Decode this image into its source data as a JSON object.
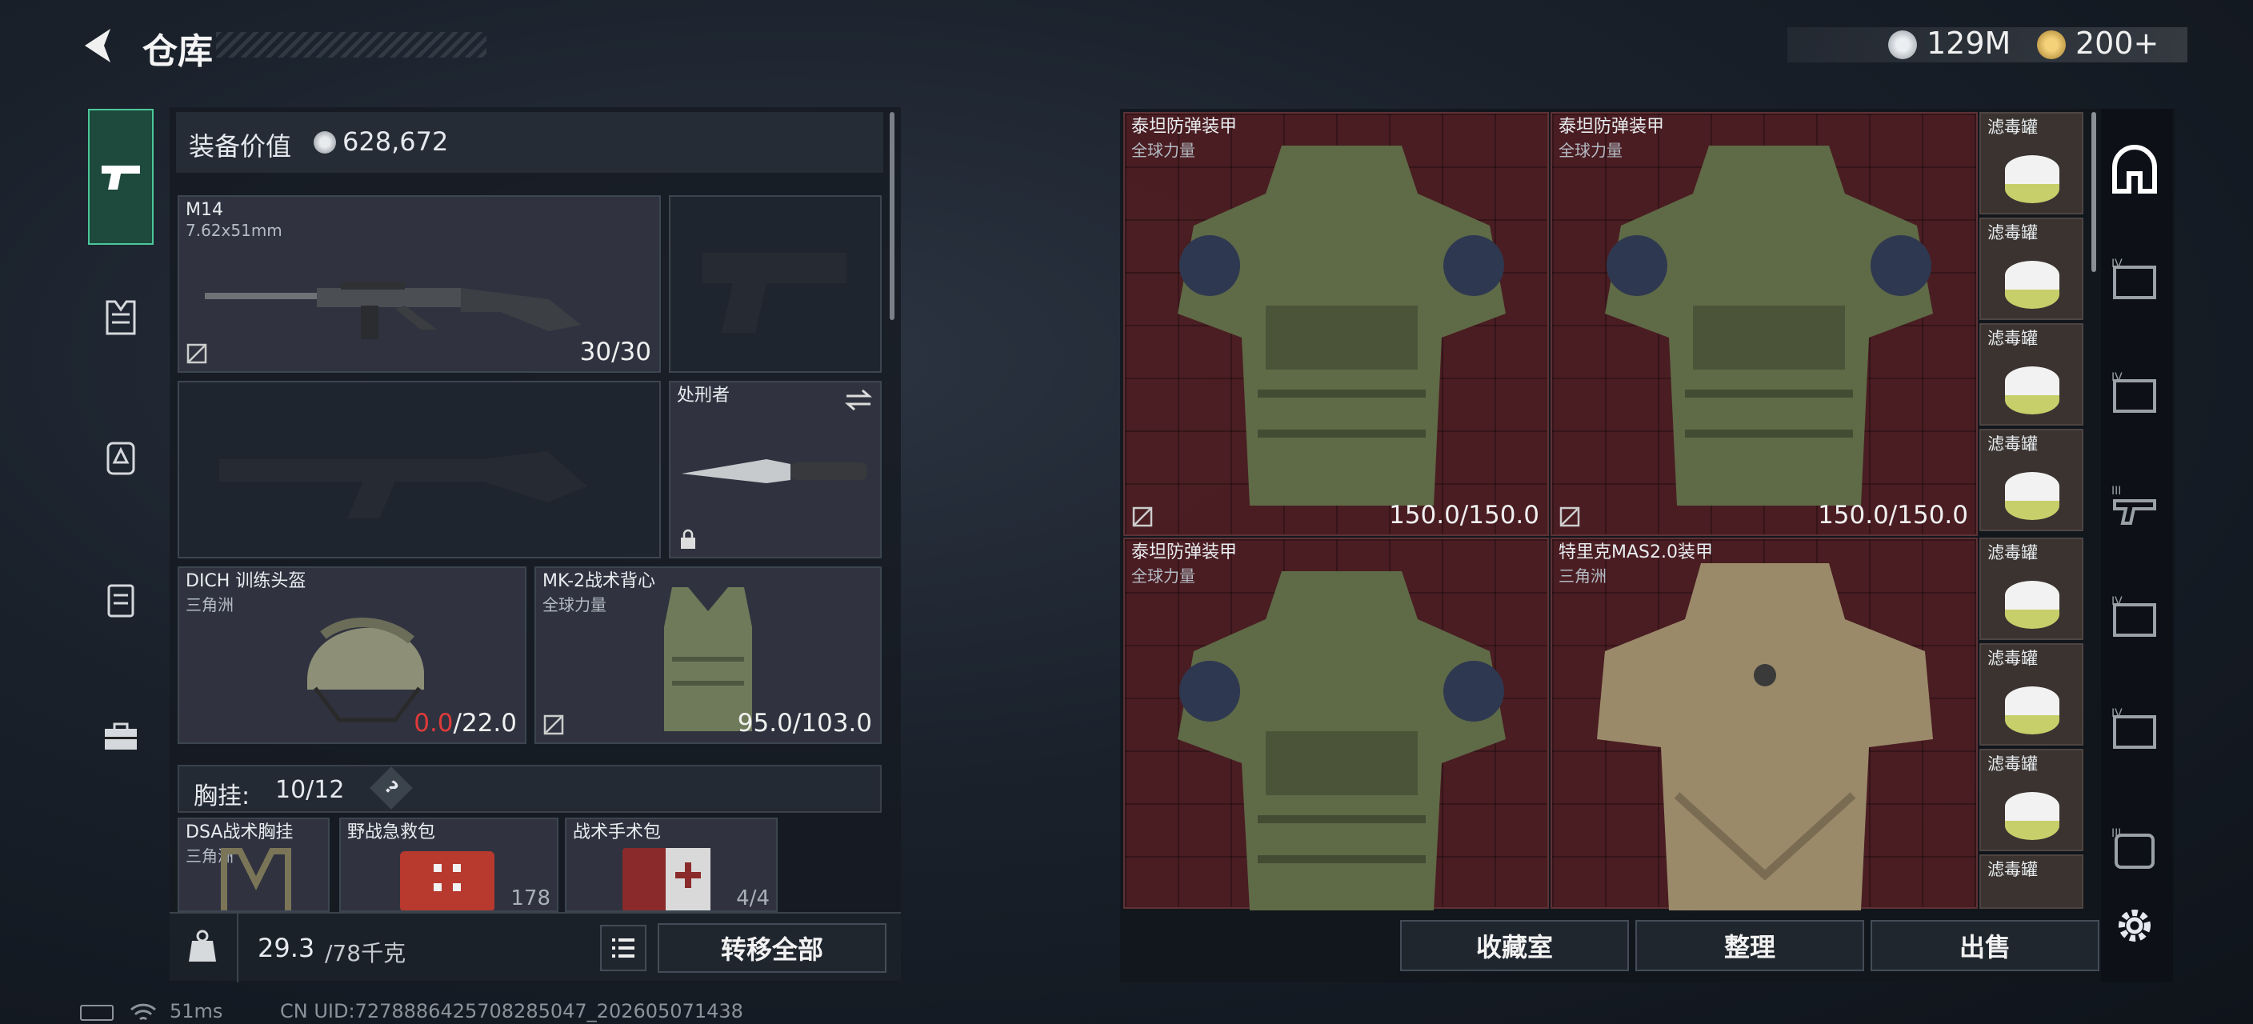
{
  "header": {
    "title": "仓库",
    "currency1": "129M",
    "currency2": "200+"
  },
  "loadout": {
    "value_label": "装备价值",
    "value": "628,672",
    "primary": {
      "name": "M14",
      "caliber": "7.62x51mm",
      "ammo": "30/30"
    },
    "melee": {
      "name": "处刑者"
    },
    "helmet": {
      "name": "DICH 训练头盔",
      "origin": "三角洲",
      "current": "0.0",
      "max": "/22.0"
    },
    "vest": {
      "name": "MK-2战术背心",
      "origin": "全球力量",
      "durability": "95.0/103.0"
    },
    "chest_rig": {
      "label": "胸挂:",
      "capacity": "10/12",
      "help": "?"
    },
    "items": [
      {
        "name": "DSA战术胸挂",
        "origin": "三角洲"
      },
      {
        "name": "野战急救包",
        "count": "178"
      },
      {
        "name": "战术手术包",
        "count": "4/4"
      }
    ],
    "weight": "29.3",
    "weight_max": "/78千克",
    "transfer_all": "转移全部"
  },
  "stash": {
    "armors": [
      {
        "name": "泰坦防弹装甲",
        "origin": "全球力量",
        "durability": "150.0/150.0"
      },
      {
        "name": "泰坦防弹装甲",
        "origin": "全球力量",
        "durability": "150.0/150.0"
      },
      {
        "name": "泰坦防弹装甲",
        "origin": "全球力量"
      },
      {
        "name": "特里克MAS2.0装甲",
        "origin": "三角洲"
      }
    ],
    "filter_name": "滤毒罐",
    "buttons": {
      "collection": "收藏室",
      "sort": "整理",
      "sell": "出售"
    }
  },
  "status": {
    "latency": "51ms",
    "uid": "CN UID:7278886425708285047_202605071438"
  },
  "colors": {
    "accent": "#4cc79a",
    "red_value": "#e03a3a",
    "armor_bg": "#5f2024"
  }
}
